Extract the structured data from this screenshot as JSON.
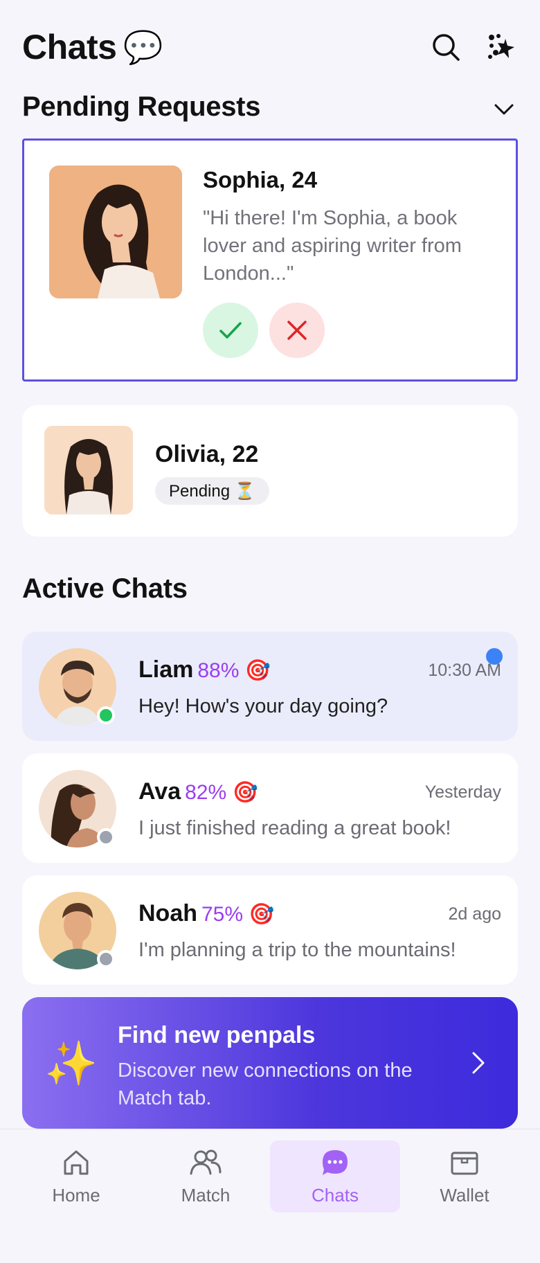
{
  "header": {
    "title": "Chats",
    "title_emoji": "💬"
  },
  "pending_section": {
    "title": "Pending Requests"
  },
  "request": {
    "name": "Sophia, 24",
    "message": "\"Hi there! I'm Sophia, a book lover and aspiring writer from London...\""
  },
  "pending_item": {
    "name": "Olivia, 22",
    "status": "Pending ⏳"
  },
  "active_section": {
    "title": "Active Chats"
  },
  "chats": [
    {
      "name": "Liam",
      "match": "88% 🎯",
      "time": "10:30 AM",
      "message": "Hey! How's your day going?",
      "online": true,
      "unread": true
    },
    {
      "name": "Ava",
      "match": "82% 🎯",
      "time": "Yesterday",
      "message": "I just finished reading a great book!",
      "online": false,
      "unread": false
    },
    {
      "name": "Noah",
      "match": "75% 🎯",
      "time": "2d ago",
      "message": "I'm planning a trip to the mountains!",
      "online": false,
      "unread": false
    }
  ],
  "promo": {
    "emoji": "✨",
    "title": "Find new penpals",
    "subtitle": "Discover new connections on the Match tab."
  },
  "tabs": [
    {
      "label": "Home",
      "icon": "home-icon"
    },
    {
      "label": "Match",
      "icon": "users-icon"
    },
    {
      "label": "Chats",
      "icon": "chat-bubble-icon",
      "active": true
    },
    {
      "label": "Wallet",
      "icon": "wallet-icon"
    }
  ],
  "colors": {
    "accent": "#5b50e3",
    "match": "#9b3df0",
    "online": "#22c55e",
    "offline": "#9ca3af",
    "unread": "#3b82f6"
  }
}
